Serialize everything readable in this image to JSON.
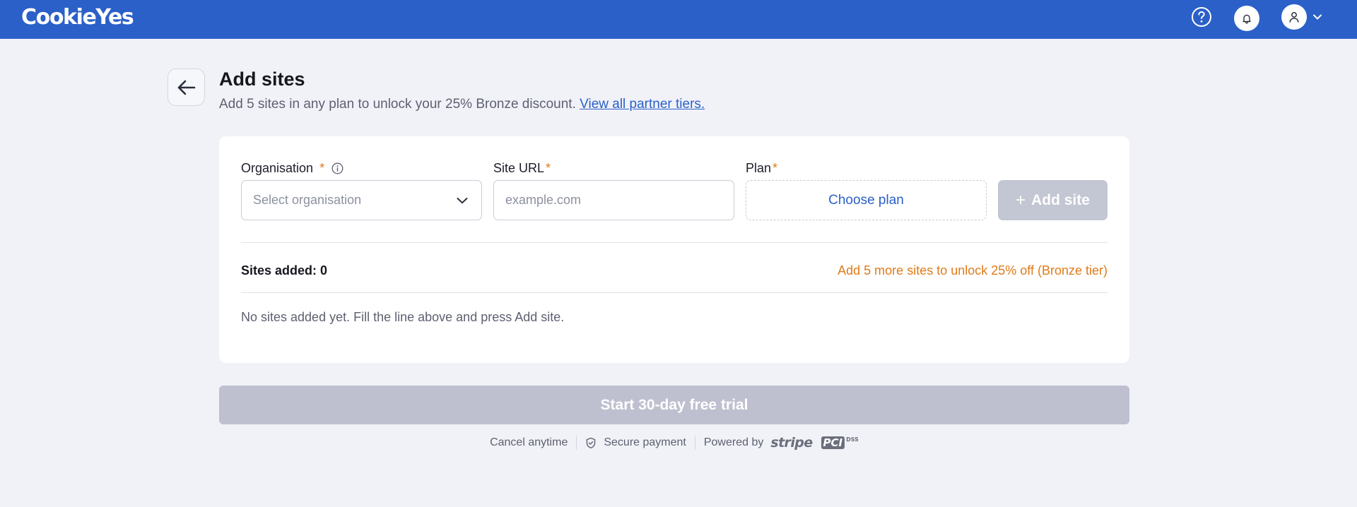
{
  "topbar": {
    "logo_text": "CookieYes",
    "help_icon": "question-circle-icon",
    "notification_icon": "bell-icon",
    "user_icon": "user-icon",
    "menu_icon": "chevron-down-icon",
    "background": "#2b60c8"
  },
  "header": {
    "back_icon": "arrow-left-icon",
    "title": "Add sites",
    "subtitle": "Add 5 sites in any plan to unlock your 25% Bronze discount.",
    "partner_link": "View all partner tiers."
  },
  "form": {
    "organisation_label": "Organisation",
    "organisation_required": "*",
    "organisation_info_icon": "info-circle-icon",
    "organisation_placeholder": "Select organisation",
    "site_url_label": "Site URL",
    "site_url_required": "*",
    "site_url_placeholder": "example.com",
    "site_url_value": "",
    "plan_label": "Plan",
    "plan_required": "*",
    "plan_button": "Choose plan",
    "add_site_plus": "+",
    "add_site_label": "Add site"
  },
  "summary": {
    "sites_added": "Sites added: 0",
    "unlock_hint": "Add 5 more sites to unlock 25% off (Bronze tier)",
    "empty_message": "No sites added yet. Fill the line above and press Add site."
  },
  "actions": {
    "trial_button": "Start 30-day free trial"
  },
  "footer": {
    "cancel": "Cancel anytime",
    "secure_icon": "shield-check-icon",
    "secure": "Secure payment",
    "powered_by": "Powered by",
    "stripe_logo": "stripe",
    "pci_logo": "PCI",
    "pci_dss": "DSS"
  },
  "colors": {
    "accent": "#2b60c8",
    "warning": "#e07a18",
    "disabled": "#c3c6d3"
  }
}
